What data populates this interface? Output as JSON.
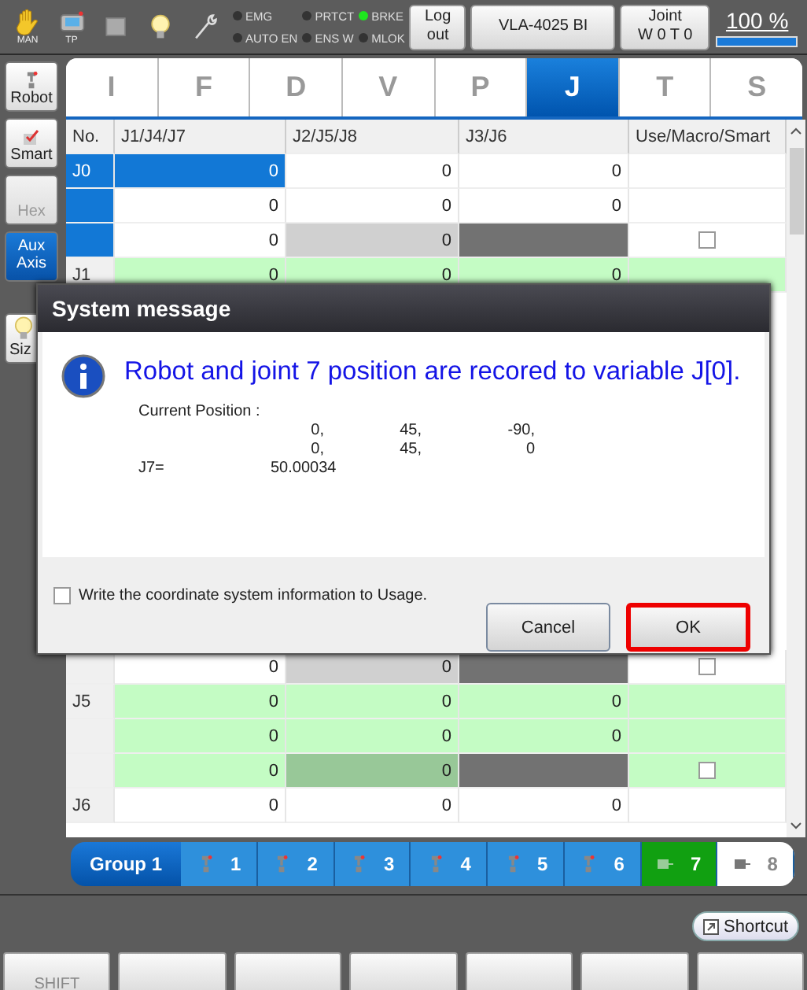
{
  "toolbar": {
    "icons": [
      {
        "kind": "hand",
        "caption": "MAN"
      },
      {
        "kind": "pendant",
        "caption": "TP"
      },
      {
        "kind": "square"
      },
      {
        "kind": "bulb"
      },
      {
        "kind": "wrench"
      }
    ],
    "indicators": [
      {
        "label": "EMG",
        "on": false
      },
      {
        "label": "AUTO EN",
        "on": false
      },
      {
        "label": "PRTCT",
        "on": false
      },
      {
        "label": "ENS W",
        "on": false
      },
      {
        "label": "BRKE",
        "on": true
      },
      {
        "label": "MLOK",
        "on": false
      }
    ],
    "buttons": [
      {
        "lines": [
          "Log",
          "out"
        ]
      },
      {
        "lines": [
          "VLA-4025 BI"
        ]
      },
      {
        "lines": [
          "Joint",
          "W 0 T 0"
        ]
      }
    ],
    "speed": {
      "text": "100 %",
      "level": 1.0
    }
  },
  "sidebar": {
    "modes": [
      {
        "label": "Robot",
        "kind": "robot",
        "disabled": false,
        "selected": false
      },
      {
        "label": "Smart",
        "kind": "smart",
        "disabled": false,
        "selected": false
      },
      {
        "label": "Hex",
        "kind": "hex",
        "disabled": true,
        "selected": false
      },
      {
        "label": "Aux Axis",
        "kind": "aux",
        "disabled": false,
        "selected": true
      }
    ],
    "tools": [
      {
        "label": "Siz",
        "kind": "size"
      }
    ]
  },
  "tabs": [
    {
      "label": "I",
      "selected": false
    },
    {
      "label": "F",
      "selected": false
    },
    {
      "label": "D",
      "selected": false
    },
    {
      "label": "V",
      "selected": false
    },
    {
      "label": "P",
      "selected": false
    },
    {
      "label": "J",
      "selected": true
    },
    {
      "label": "T",
      "selected": false
    },
    {
      "label": "S",
      "selected": false
    }
  ],
  "table": {
    "columns": [
      "No.",
      "J1/J4/J7",
      "J2/J5/J8",
      "J3/J6",
      "Use/Macro/Smart"
    ],
    "rows_above_dialog": [
      {
        "no": "J0",
        "values": [
          "0",
          "0",
          "0"
        ],
        "kind": "main",
        "selected": true,
        "highlight": false,
        "focused": true
      },
      {
        "values": [
          "0",
          "0",
          "0"
        ],
        "kind": "main",
        "selected": true,
        "highlight": false,
        "focused": false
      },
      {
        "values": [
          "0",
          "0"
        ],
        "kind": "extra",
        "selected": true,
        "highlight": false,
        "focused": false,
        "checked": false
      },
      {
        "no": "J1",
        "values": [
          "0",
          "0",
          "0"
        ],
        "kind": "main",
        "selected": false,
        "highlight": true,
        "focused": false
      }
    ],
    "rows_below_dialog": [
      {
        "values": [
          "0",
          "0"
        ],
        "kind": "extra",
        "selected": false,
        "highlight": false,
        "focused": false,
        "checked": false
      },
      {
        "no": "J5",
        "values": [
          "0",
          "0",
          "0"
        ],
        "kind": "main",
        "selected": false,
        "highlight": true,
        "focused": false
      },
      {
        "values": [
          "0",
          "0",
          "0"
        ],
        "kind": "main",
        "selected": false,
        "highlight": true,
        "focused": false
      },
      {
        "values": [
          "0",
          "0"
        ],
        "kind": "extra",
        "selected": false,
        "highlight": true,
        "focused": false,
        "checked": false
      },
      {
        "no": "J6",
        "values": [
          "0",
          "0",
          "0"
        ],
        "kind": "main",
        "selected": false,
        "highlight": false,
        "focused": false
      }
    ]
  },
  "dialog": {
    "title": "System message",
    "message": "Robot and joint 7 position are recored to variable J[0].",
    "details": {
      "heading": "Current Position :",
      "rows": [
        [
          "0,",
          "45,",
          "-90,"
        ],
        [
          "0,",
          "45,",
          "0"
        ]
      ],
      "j7_label": "J7=",
      "j7_value": "50.00034"
    },
    "option": {
      "label": "Write the coordinate system information to Usage.",
      "checked": false
    },
    "buttons": [
      {
        "label": "Cancel",
        "highlighted": false
      },
      {
        "label": "OK",
        "highlighted": true
      }
    ]
  },
  "group_bar": {
    "group": {
      "label": "Group 1",
      "selected": true
    },
    "axes": [
      {
        "label": "1",
        "kind": "robot",
        "on": true
      },
      {
        "label": "2",
        "kind": "robot",
        "on": true
      },
      {
        "label": "3",
        "kind": "robot",
        "on": true
      },
      {
        "label": "4",
        "kind": "robot",
        "on": true
      },
      {
        "label": "5",
        "kind": "robot",
        "on": true
      },
      {
        "label": "6",
        "kind": "robot",
        "on": true
      },
      {
        "label": "7",
        "kind": "aux",
        "on": true
      },
      {
        "label": "8",
        "kind": "aux",
        "on": false
      }
    ]
  },
  "shortcut": {
    "label": "Shortcut"
  },
  "function_keys": [
    {
      "kind": "shift",
      "label": "SHIFT"
    },
    {
      "kind": "blank"
    },
    {
      "kind": "blank"
    },
    {
      "kind": "blank"
    },
    {
      "kind": "blank"
    },
    {
      "kind": "blank"
    },
    {
      "kind": "blank"
    }
  ]
}
